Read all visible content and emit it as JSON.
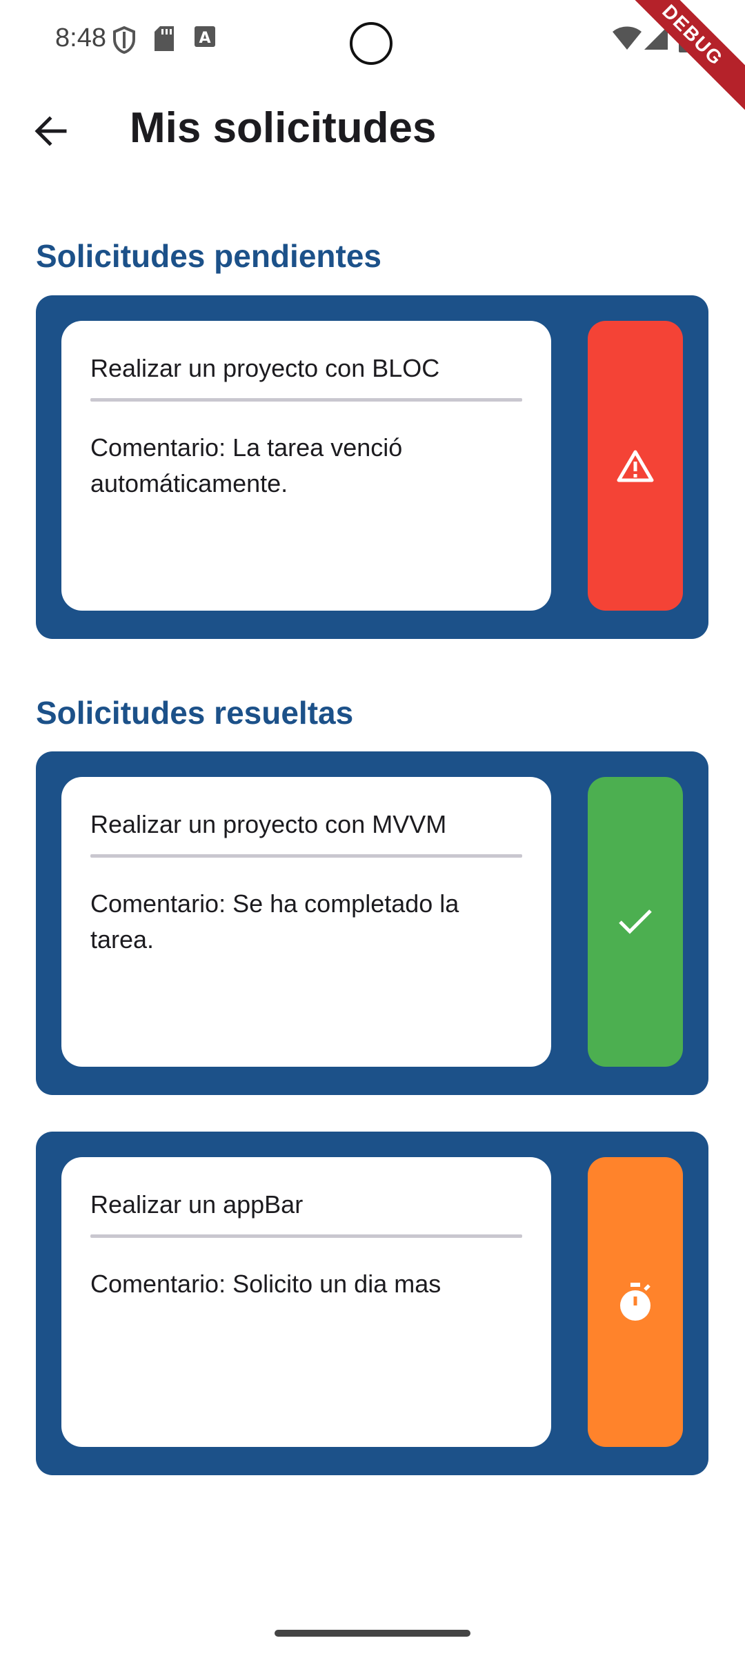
{
  "status_bar": {
    "time": "8:48",
    "icons_left": [
      "shield-icon",
      "sd-card-icon",
      "text-a-icon"
    ],
    "icons_right": [
      "wifi-icon",
      "signal-icon",
      "battery-icon"
    ],
    "debug_banner": "DEBUG"
  },
  "app_bar": {
    "back_icon": "arrow-back-icon",
    "title": "Mis solicitudes"
  },
  "colors": {
    "primary": "#1c5189",
    "danger": "#f44336",
    "success": "#4caf50",
    "warning": "#ff832b"
  },
  "pending": {
    "section_title": "Solicitudes pendientes",
    "items": [
      {
        "title": "Realizar un proyecto con BLOC",
        "comment": "Comentario: La tarea venció automáticamente.",
        "status_icon": "warning-icon",
        "status_color": "#f44336"
      }
    ]
  },
  "resolved": {
    "section_title": "Solicitudes resueltas",
    "items": [
      {
        "title": "Realizar un proyecto con MVVM",
        "comment": "Comentario: Se ha completado la tarea.",
        "status_icon": "check-icon",
        "status_color": "#4caf50"
      },
      {
        "title": "Realizar un appBar",
        "comment": "Comentario: Solicito un dia mas",
        "status_icon": "timer-icon",
        "status_color": "#ff832b"
      }
    ]
  }
}
